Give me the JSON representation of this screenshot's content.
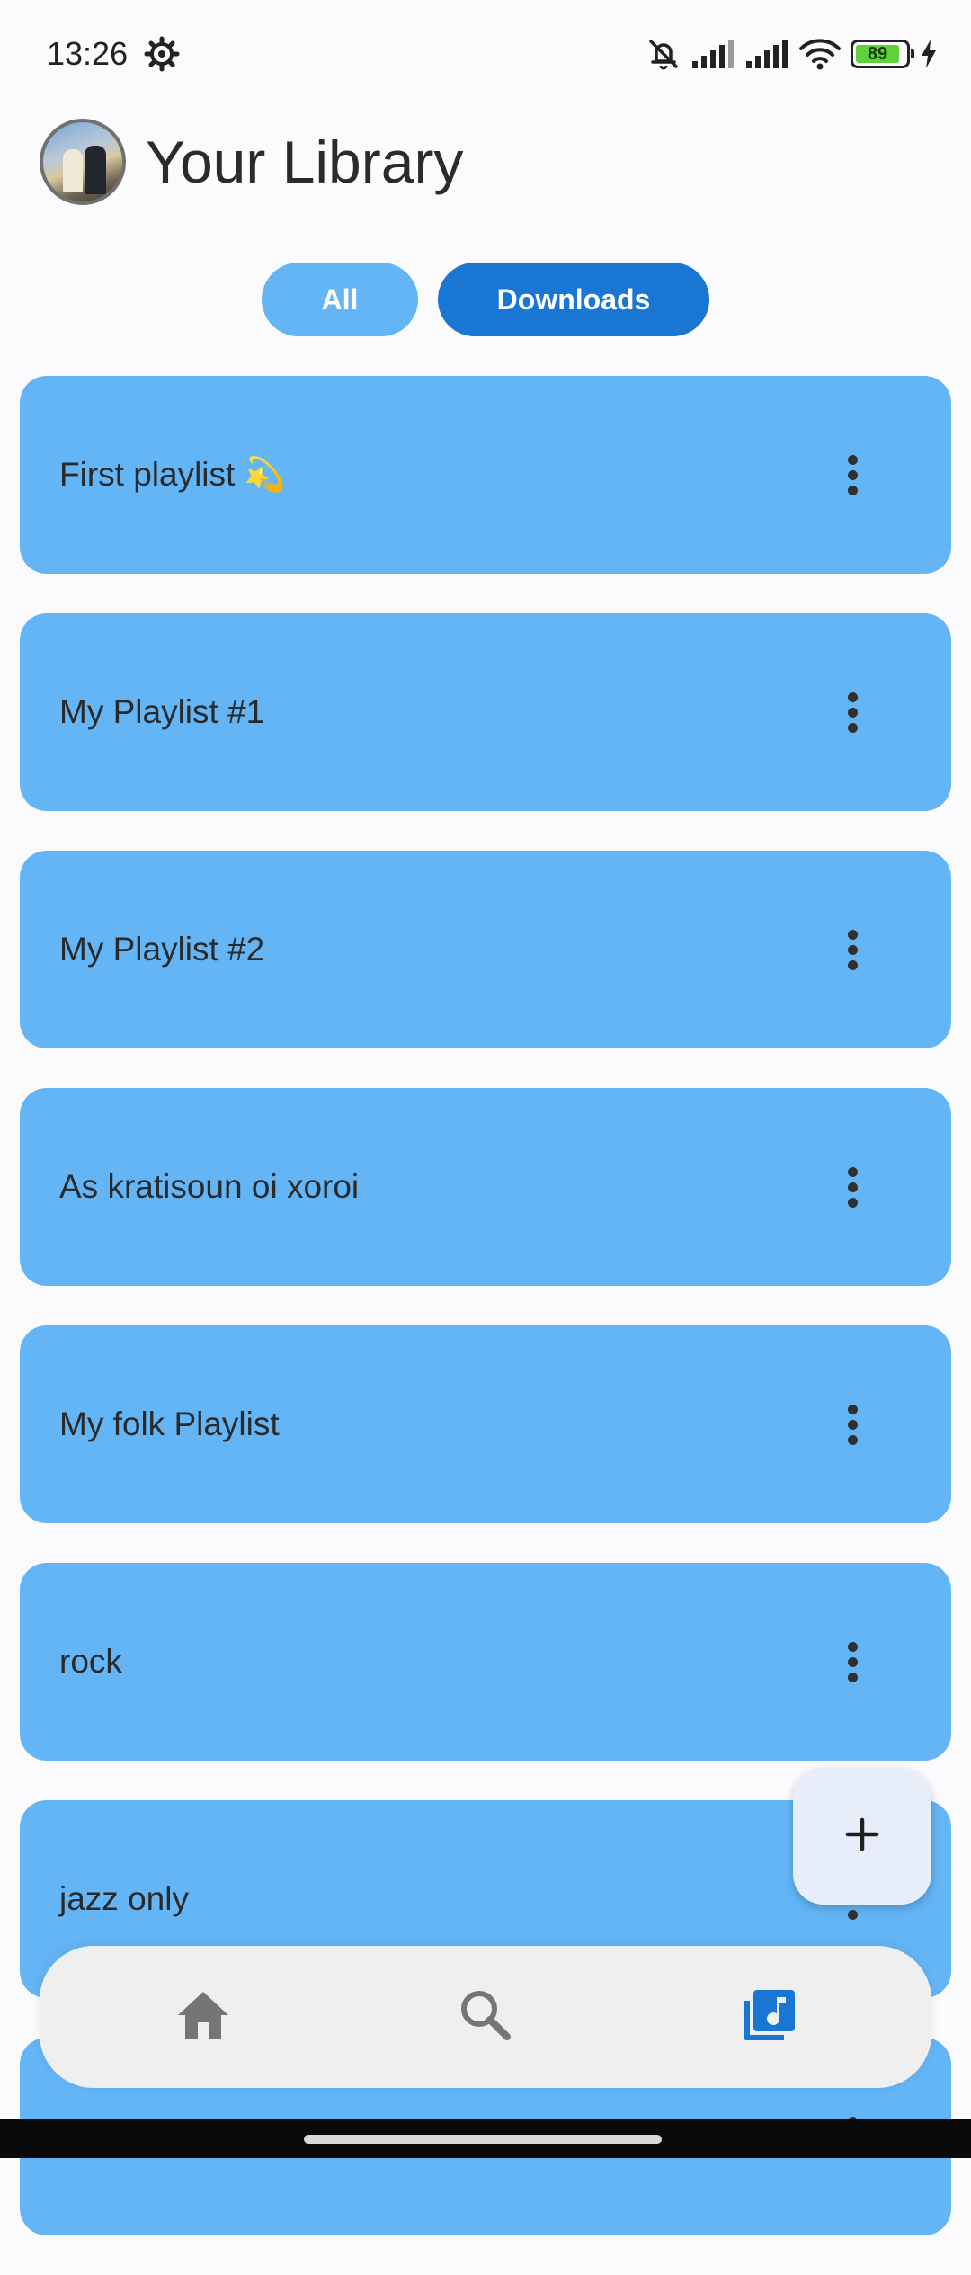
{
  "status_bar": {
    "time": "13:26",
    "battery_level": "89",
    "icons": [
      "gear-icon",
      "bell-off-icon",
      "signal-icon",
      "signal-icon",
      "wifi-icon",
      "battery-icon",
      "charging-icon"
    ]
  },
  "header": {
    "title": "Your Library",
    "avatar_icon": "avatar"
  },
  "filters": [
    {
      "label": "All",
      "selected": false
    },
    {
      "label": "Downloads",
      "selected": true
    }
  ],
  "playlists": [
    {
      "name": "First playlist 💫"
    },
    {
      "name": "My Playlist #1"
    },
    {
      "name": "My Playlist #2"
    },
    {
      "name": "As kratisoun oi xoroi"
    },
    {
      "name": "My folk Playlist"
    },
    {
      "name": "rock"
    },
    {
      "name": "jazz only"
    },
    {
      "name": ""
    }
  ],
  "fab": {
    "icon": "plus-icon"
  },
  "bottom_nav": {
    "items": [
      {
        "icon": "home-icon",
        "active": false
      },
      {
        "icon": "search-icon",
        "active": false
      },
      {
        "icon": "library-music-icon",
        "active": true
      }
    ]
  },
  "colors": {
    "background": "#fbfbfd",
    "card": "#64b5f6",
    "chip_all": "#64b5f6",
    "chip_selected": "#1976d2",
    "nav_active": "#1976d2",
    "nav_inactive": "#757575"
  }
}
